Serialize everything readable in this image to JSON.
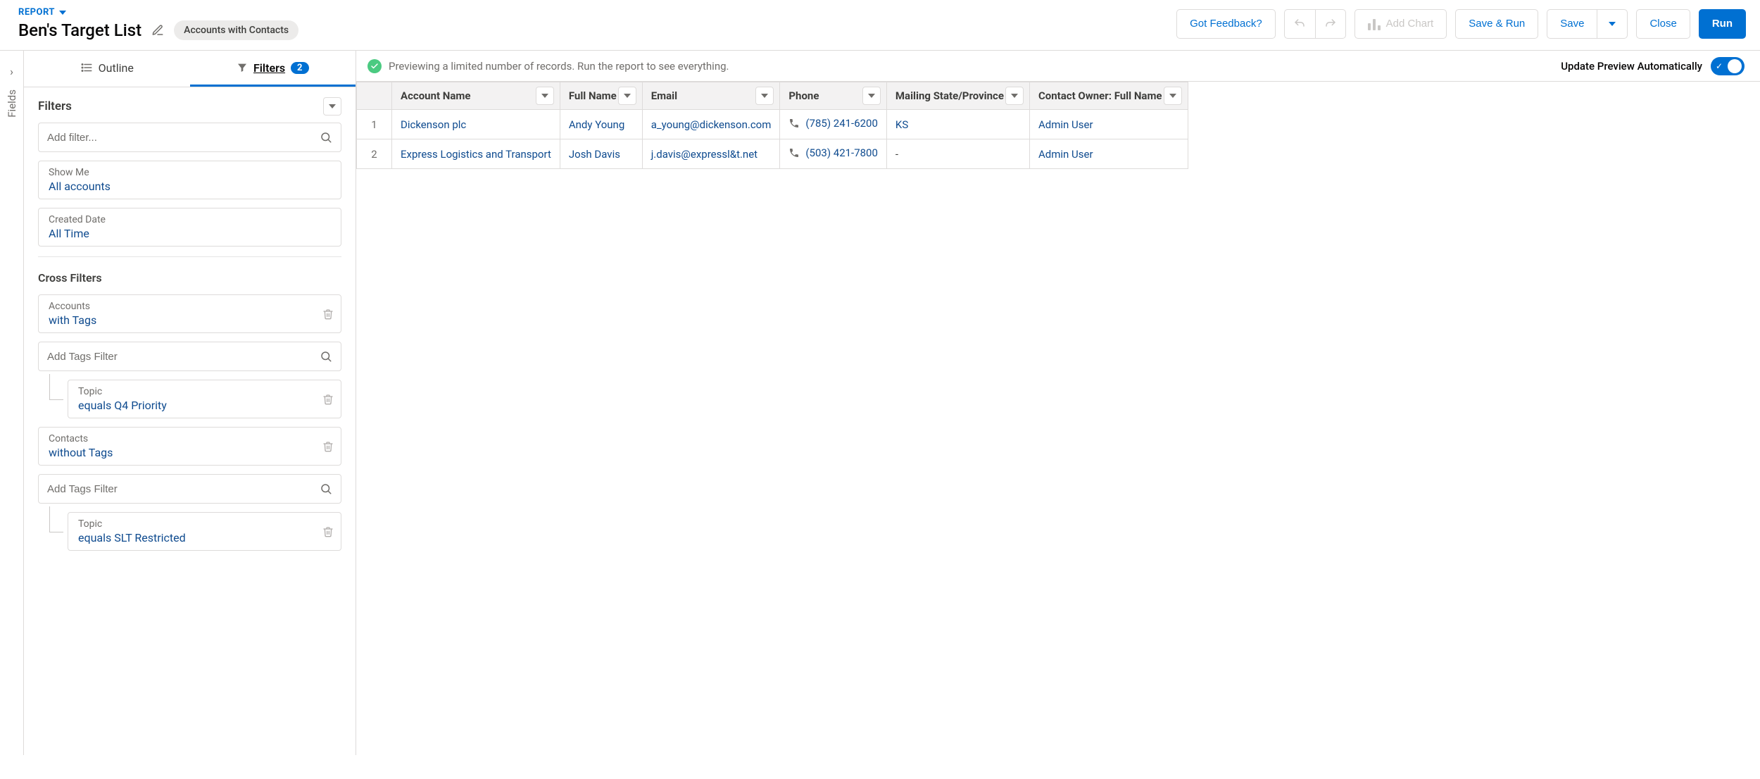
{
  "header": {
    "type_label": "REPORT",
    "title": "Ben's Target List",
    "subtype": "Accounts with Contacts",
    "buttons": {
      "feedback": "Got Feedback?",
      "add_chart": "Add Chart",
      "save_run": "Save & Run",
      "save": "Save",
      "close": "Close",
      "run": "Run"
    }
  },
  "fields_rail": {
    "label": "Fields"
  },
  "side": {
    "tabs": {
      "outline": "Outline",
      "filters": "Filters",
      "filters_count": "2"
    },
    "filters_heading": "Filters",
    "add_filter_placeholder": "Add filter...",
    "show_me": {
      "label": "Show Me",
      "value": "All accounts"
    },
    "created_date": {
      "label": "Created Date",
      "value": "All Time"
    },
    "cross_heading": "Cross Filters",
    "cross1": {
      "label": "Accounts",
      "value": "with Tags"
    },
    "cross1_add_placeholder": "Add Tags Filter",
    "cross1_child": {
      "label": "Topic",
      "value": "equals Q4 Priority"
    },
    "cross2": {
      "label": "Contacts",
      "value": "without Tags"
    },
    "cross2_add_placeholder": "Add Tags Filter",
    "cross2_child": {
      "label": "Topic",
      "value": "equals SLT Restricted"
    }
  },
  "preview": {
    "message": "Previewing a limited number of records. Run the report to see everything.",
    "auto_label": "Update Preview Automatically"
  },
  "table": {
    "columns": [
      "Account Name",
      "Full Name",
      "Email",
      "Phone",
      "Mailing State/Province",
      "Contact Owner: Full Name"
    ],
    "rows": [
      {
        "n": "1",
        "account": "Dickenson plc",
        "name": "Andy Young",
        "email": "a_young@dickenson.com",
        "phone": "(785) 241-6200",
        "state": "KS",
        "owner": "Admin User"
      },
      {
        "n": "2",
        "account": "Express Logistics and Transport",
        "name": "Josh Davis",
        "email": "j.davis@expressl&t.net",
        "phone": "(503) 421-7800",
        "state": "-",
        "owner": "Admin User"
      }
    ]
  }
}
